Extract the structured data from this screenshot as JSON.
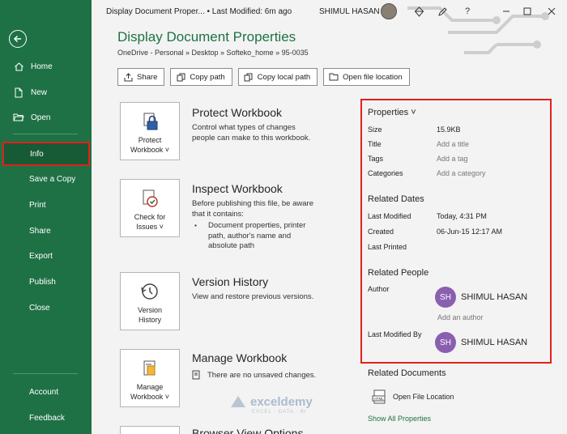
{
  "sidebar": {
    "items": [
      {
        "label": "Home"
      },
      {
        "label": "New"
      },
      {
        "label": "Open"
      },
      {
        "label": "Info"
      },
      {
        "label": "Save a Copy"
      },
      {
        "label": "Print"
      },
      {
        "label": "Share"
      },
      {
        "label": "Export"
      },
      {
        "label": "Publish"
      },
      {
        "label": "Close"
      },
      {
        "label": "Account"
      },
      {
        "label": "Feedback"
      }
    ],
    "active_item": "Info",
    "bg_color": "#1e7145"
  },
  "topbar": {
    "doc_title": "Display Document Proper...  •  Last Modified: 6m ago",
    "user_name": "SHIMUL HASAN"
  },
  "header": {
    "title": "Display Document Properties",
    "breadcrumb": "OneDrive - Personal » Desktop » Softeko_home » 95-0035"
  },
  "actions": {
    "share": "Share",
    "copy_path": "Copy path",
    "copy_local_path": "Copy local path",
    "open_file_location": "Open file location"
  },
  "sections": {
    "protect": {
      "card_line1": "Protect",
      "card_line2": "Workbook ˅",
      "title": "Protect Workbook",
      "desc": "Control what types of changes people can make to this workbook."
    },
    "inspect": {
      "card_line1": "Check for",
      "card_line2": "Issues ˅",
      "title": "Inspect Workbook",
      "desc": "Before publishing this file, be aware that it contains:",
      "bullet": "Document properties, printer path, author's name and absolute path"
    },
    "version": {
      "card_line1": "Version",
      "card_line2": "History",
      "title": "Version History",
      "desc": "View and restore previous versions."
    },
    "manage": {
      "card_line1": "Manage",
      "card_line2": "Workbook ˅",
      "title": "Manage Workbook",
      "desc": "There are no unsaved changes."
    },
    "browser": {
      "title": "Browser View Options"
    }
  },
  "properties": {
    "heading": "Properties ˅",
    "size_label": "Size",
    "size_value": "15.9KB",
    "title_label": "Title",
    "title_value": "Add a title",
    "tags_label": "Tags",
    "tags_value": "Add a tag",
    "categories_label": "Categories",
    "categories_value": "Add a category",
    "dates_heading": "Related Dates",
    "modified_label": "Last Modified",
    "modified_value": "Today, 4:31 PM",
    "created_label": "Created",
    "created_value": "06-Jun-15 12:17 AM",
    "printed_label": "Last Printed",
    "people_heading": "Related People",
    "author_label": "Author",
    "author_initials": "SH",
    "author_name": "SHIMUL HASAN",
    "add_author": "Add an author",
    "modified_by_label": "Last Modified By",
    "modified_by_initials": "SH",
    "modified_by_name": "SHIMUL HASAN",
    "highlight_color": "#e0211b"
  },
  "related_documents": {
    "heading": "Related Documents",
    "open_location": "Open File Location",
    "show_all": "Show All Properties"
  },
  "watermark": {
    "text": "exceldemy",
    "sub": "EXCEL · DATA · BI"
  }
}
